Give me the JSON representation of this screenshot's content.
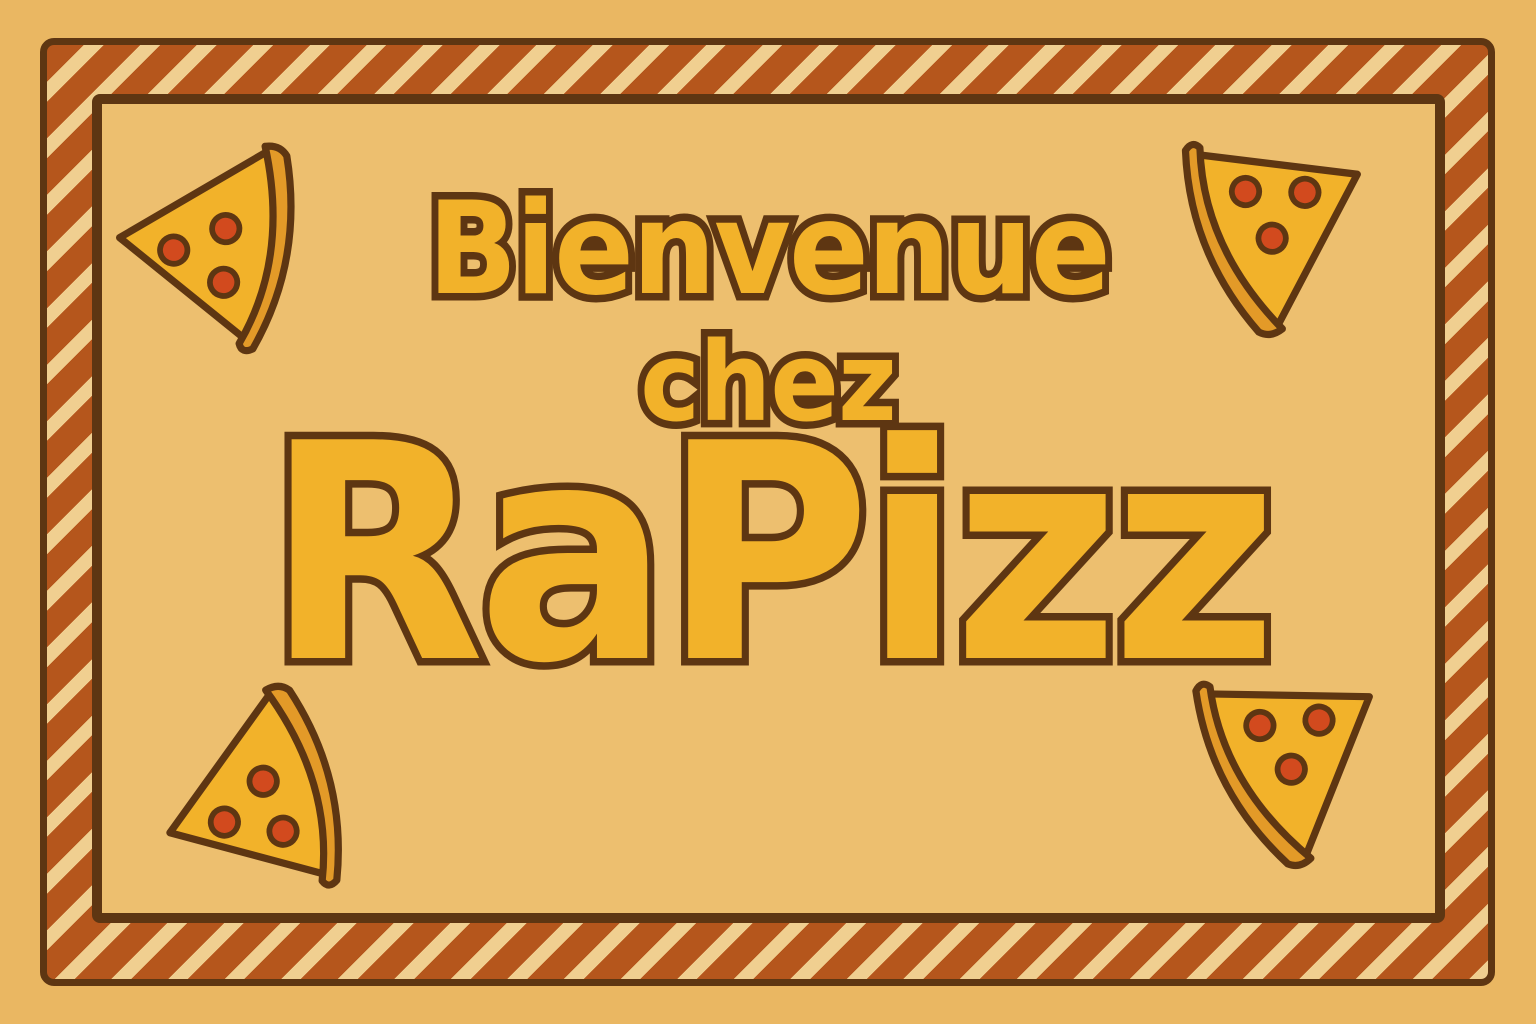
{
  "sign": {
    "line1": "Bienvenue",
    "line2": "chez",
    "brand": "RaPizz"
  },
  "decorations": {
    "icon": "pizza-slice-icon",
    "count": 4
  },
  "colors": {
    "background": "#eab762",
    "text_fill": "#f2b22a",
    "outline": "#5e3612",
    "stripe": "#b5561c",
    "pepperoni": "#d24a1e",
    "crust": "#e39a28"
  }
}
